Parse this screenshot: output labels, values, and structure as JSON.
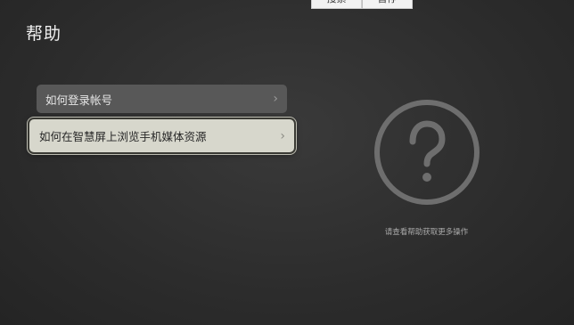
{
  "top_tabs": [
    {
      "label": "搜索"
    },
    {
      "label": "暂停"
    }
  ],
  "page_title": "帮助",
  "menu_items": [
    {
      "label": "如何登录帐号",
      "chevron": "›"
    },
    {
      "label": "如何在智慧屏上浏览手机媒体资源",
      "chevron": "›"
    }
  ],
  "help_panel": {
    "icon": "question-circle-icon",
    "hint": "请查看帮助获取更多操作"
  },
  "colors": {
    "background": "#2e2e2e",
    "item_normal": "#585858",
    "item_focused": "#d7d7cc",
    "icon": "#707070"
  }
}
